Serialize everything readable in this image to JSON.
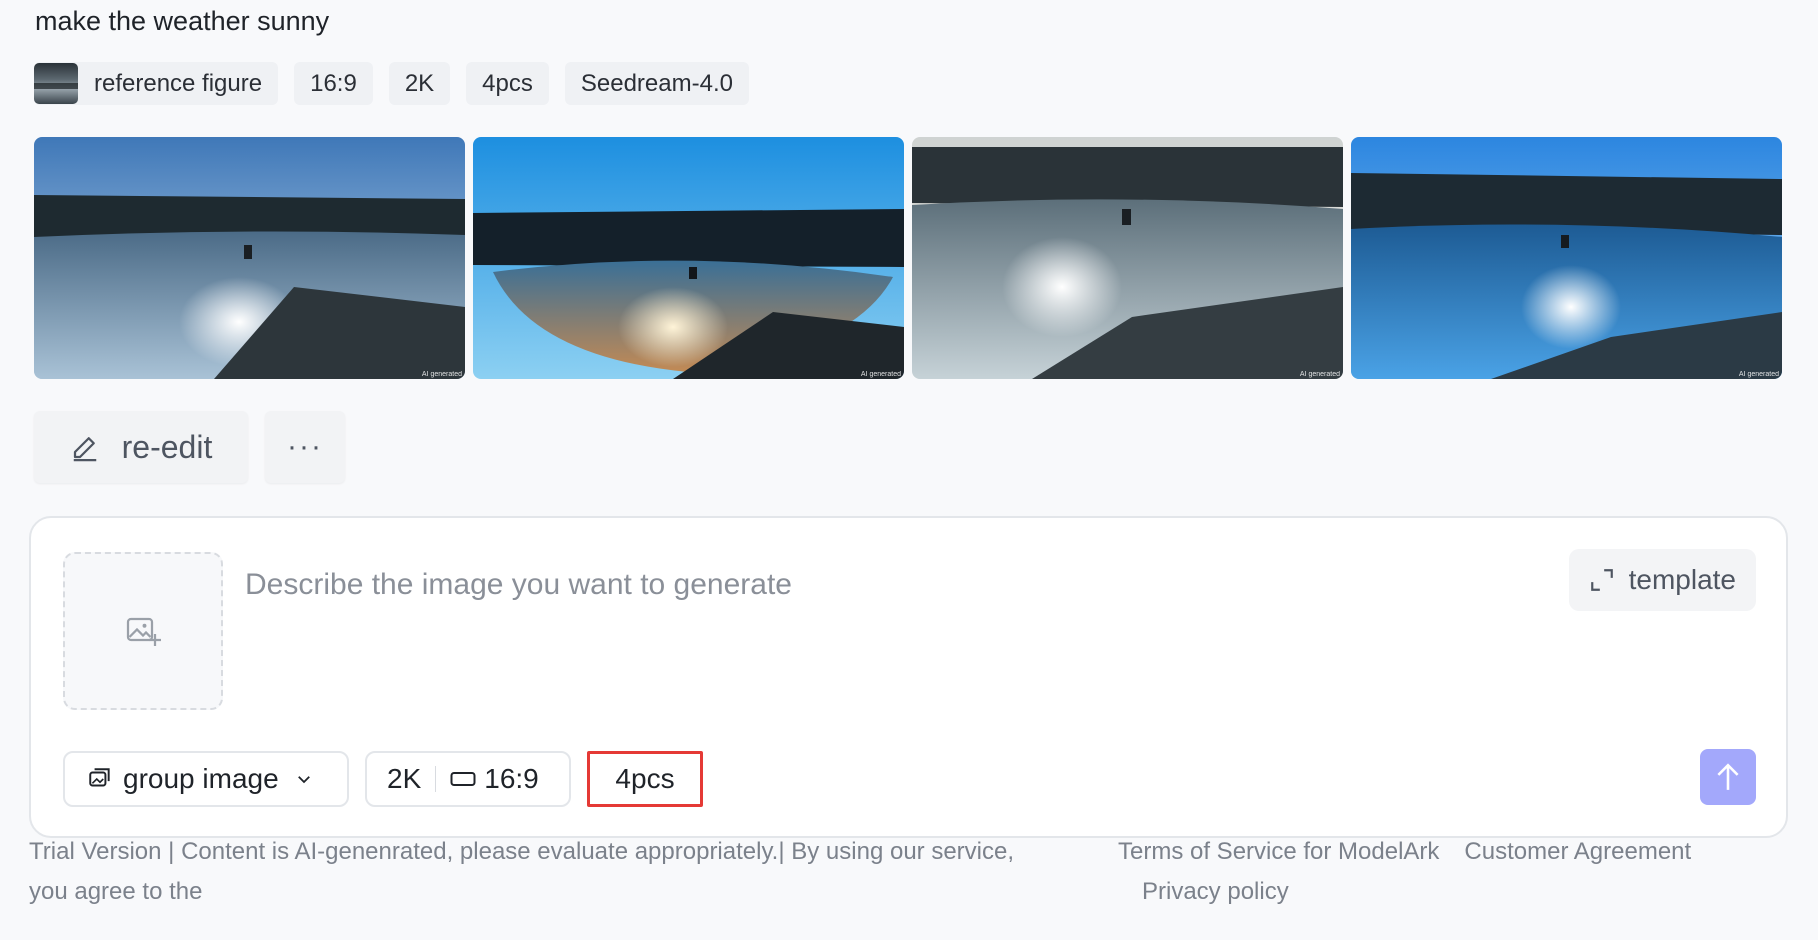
{
  "prompt": {
    "text": "make the weather sunny"
  },
  "tags": {
    "reference": "reference figure",
    "ratio": "16:9",
    "resolution": "2K",
    "count": "4pcs",
    "model": "Seedream-4.0"
  },
  "gallery": {
    "watermark": "AI generated"
  },
  "actions": {
    "re_edit": "re-edit",
    "more": "···"
  },
  "composer": {
    "placeholder": "Describe the image you want to generate",
    "template_label": "template",
    "mode": {
      "label": "group image",
      "icon": "group-image-icon"
    },
    "resolution": "2K",
    "ratio": "16:9",
    "count": "4pcs",
    "send_color": "#a3a8fb"
  },
  "footer": {
    "disclaimer": "Trial Version | Content is AI-genenrated, please evaluate appropriately.| By using our service, you agree to the",
    "terms": "Terms of Service for ModelArk",
    "agreement": "Customer Agreement",
    "privacy": "Privacy policy"
  }
}
